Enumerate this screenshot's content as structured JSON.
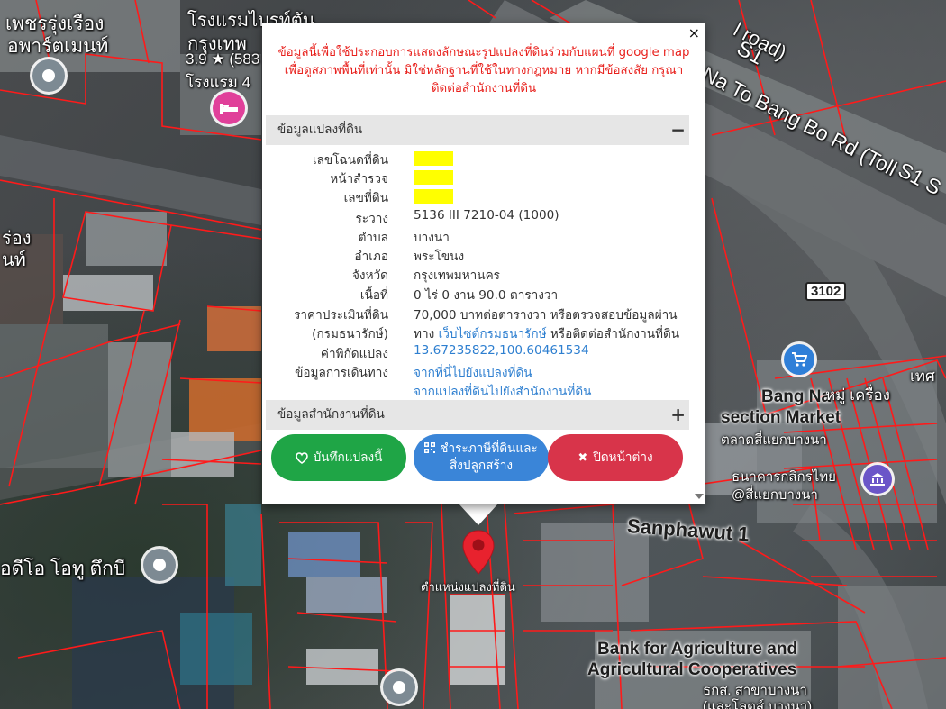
{
  "map": {
    "labels_top_left": [
      "เพชรรุ่งเรือง",
      "อพาร์ตเมนท์"
    ],
    "hotel_name": [
      "โรงแรมไบรท์ตัน",
      "กรุงเทพ"
    ],
    "hotel_rating": "3.9 ★ (583",
    "hotel_type": "โรงแรม 4",
    "road_s1": "S1",
    "road_road": "l road)",
    "road_bangna": "g Na To Bang Bo Rd (Toll",
    "road_s1_right": "S1 S",
    "left_labels": [
      "ร่อง",
      "นท์"
    ],
    "shield": "3102",
    "market_name": [
      "Bang Na",
      "section Market"
    ],
    "market_thai": "ตลาดสี่แยกบางนา",
    "market_right": [
      "เทศ",
      "หมู่ เครื่อง"
    ],
    "bank_thai_right": [
      "ธนาคารกสิกรไทย",
      "@สี่แยกบางนา"
    ],
    "sanphawut": "Sanphawut 1",
    "ideo": "อดีโอ โอทู ตึกบี",
    "bank_baac": [
      "Bank for Agriculture and",
      "Agricultural Cooperatives"
    ],
    "baac_thai": [
      "ธกส. สาขาบางนา",
      "(และโลตส์ บางนา)"
    ],
    "marker_label": "ตำแหน่งแปลงที่ดิน"
  },
  "popup": {
    "close": "×",
    "disclaimer": [
      "ข้อมูลนี้เพื่อใช้ประกอบการแสดงลักษณะรูปแปลงที่ดินร่วมกับแผนที่ google map",
      "เพื่อดูสภาพพื้นที่เท่านั้น มิใช่หลักฐานที่ใช้ในทางกฎหมาย หากมีข้อสงสัย กรุณา",
      "ติดต่อสำนักงานที่ดิน"
    ],
    "section1_title": "ข้อมูลแปลงที่ดิน",
    "section1_toggle": "−",
    "section2_title": "ข้อมูลสำนักงานที่ดิน",
    "section2_toggle": "+",
    "rows": [
      {
        "label": "เลขโฉนดที่ดิน",
        "value": ""
      },
      {
        "label": "หน้าสำรวจ",
        "value": ""
      },
      {
        "label": "เลขที่ดิน",
        "value": ""
      },
      {
        "label": "ระวาง",
        "value": "5136 III 7210-04 (1000)"
      },
      {
        "label": "ตำบล",
        "value": "บางนา"
      },
      {
        "label": "อำเภอ",
        "value": "พระโขนง"
      },
      {
        "label": "จังหวัด",
        "value": "กรุงเทพมหานคร"
      },
      {
        "label": "เนื้อที่",
        "value": "0 ไร่ 0 งาน 90.0 ตารางวา"
      },
      {
        "label": "ราคาประเมินที่ดิน",
        "value": "70,000 บาทต่อตารางวา หรือตรวจสอบข้อมูลผ่าน"
      },
      {
        "label": "(กรมธนารักษ์)",
        "value_prefix": "ทาง ",
        "value_link": "เว็บไซต์กรมธนารักษ์",
        "value_suffix": " หรือติดต่อสำนักงานที่ดิน"
      },
      {
        "label": "ค่าพิกัดแปลง",
        "value_link": "13.67235822,100.60461534"
      },
      {
        "label": "ข้อมูลการเดินทาง",
        "value_link": "จากที่นี่ไปยังแปลงที่ดิน"
      },
      {
        "label": "",
        "value_link": "จากแปลงที่ดินไปยังสำนักงานที่ดิน"
      }
    ],
    "btn_save": "บันทึกแปลงนี้",
    "btn_tax": [
      "ชำระภาษีที่ดินและ",
      "สิ่งปลูกสร้าง"
    ],
    "btn_close": "ปิดหน้าต่าง"
  },
  "colors": {
    "parcel_line": "#ff1a1a",
    "disclaimer": "#e8201c",
    "btn_save": "#1fa546",
    "btn_tax": "#3a85d8",
    "btn_close": "#d8344a",
    "highlight": "#ffff00",
    "link": "#2e7fd0"
  }
}
